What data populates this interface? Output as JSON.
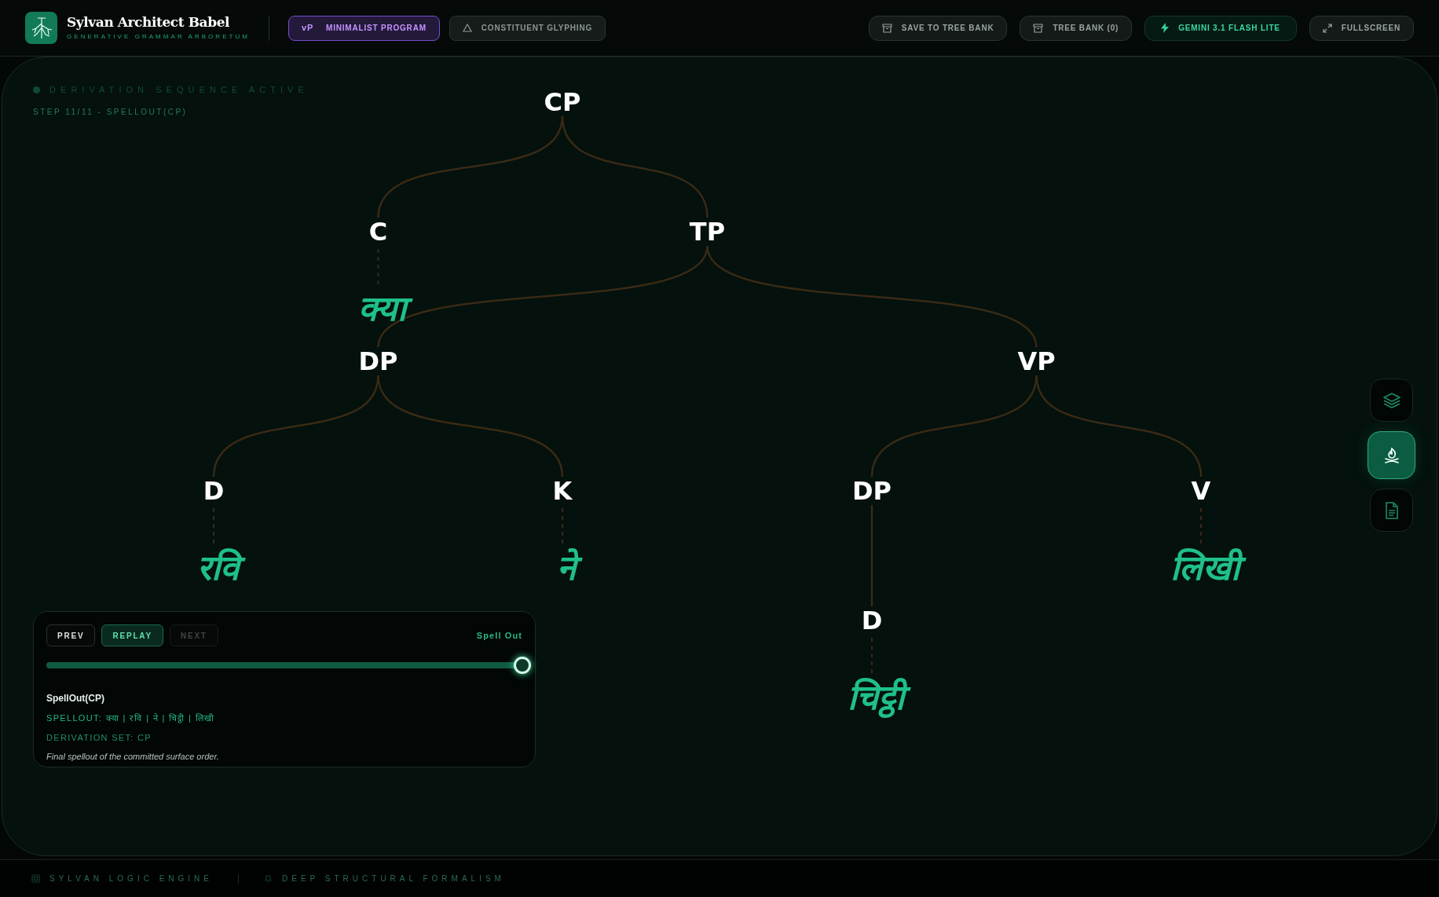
{
  "header": {
    "title": "Sylvan Architect Babel",
    "subtitle": "GENERATIVE GRAMMAR ARBORETUM",
    "modes": [
      {
        "badge": "vP",
        "label": "MINIMALIST PROGRAM",
        "selected": true
      },
      {
        "label": "CONSTITUENT GLYPHING",
        "selected": false
      }
    ],
    "actions": [
      {
        "label": "SAVE TO TREE BANK",
        "kind": "archive"
      },
      {
        "label": "TREE BANK (0)",
        "kind": "archive"
      },
      {
        "label": "GEMINI 3.1 FLASH LITE",
        "kind": "model"
      },
      {
        "label": "FULLSCREEN",
        "kind": "expand"
      }
    ]
  },
  "canvas": {
    "status": "DERIVATION SEQUENCE ACTIVE",
    "step": "STEP 11/11 - SPELLOUT(CP)",
    "tree": {
      "label": "CP",
      "children": [
        {
          "label": "C",
          "word": "क्या"
        },
        {
          "label": "TP",
          "children": [
            {
              "label": "DP",
              "children": [
                {
                  "label": "D",
                  "word": "रवि"
                },
                {
                  "label": "K",
                  "word": "ने"
                }
              ]
            },
            {
              "label": "VP",
              "children": [
                {
                  "label": "DP",
                  "children": [
                    {
                      "label": "D",
                      "word": "चिट्ठी"
                    }
                  ]
                },
                {
                  "label": "V",
                  "word": "लिखी"
                }
              ]
            }
          ]
        }
      ]
    }
  },
  "player": {
    "buttons": [
      {
        "label": "PREV",
        "highlighted": false,
        "disabled": false
      },
      {
        "label": "REPLAY",
        "highlighted": true,
        "disabled": false
      },
      {
        "label": "NEXT",
        "highlighted": false,
        "disabled": true
      }
    ],
    "phase": "Spell Out",
    "scrubber": {
      "level": 1
    },
    "operation": "SpellOut(CP)",
    "spellout": "SPELLOUT: क्या | रवि | ने | चिट्ठी | लिखी",
    "derivation_set": "DERIVATION SET: CP",
    "note": "Final spellout of the committed surface order."
  },
  "tools": [
    {
      "kind": "layers",
      "selected": false
    },
    {
      "kind": "campfire",
      "selected": true
    },
    {
      "kind": "document",
      "selected": false
    }
  ],
  "footer": [
    {
      "kind": "chip",
      "label": "SYLVAN LOGIC ENGINE"
    },
    {
      "kind": "bell",
      "label": "DEEP STRUCTURAL FORMALISM"
    }
  ]
}
